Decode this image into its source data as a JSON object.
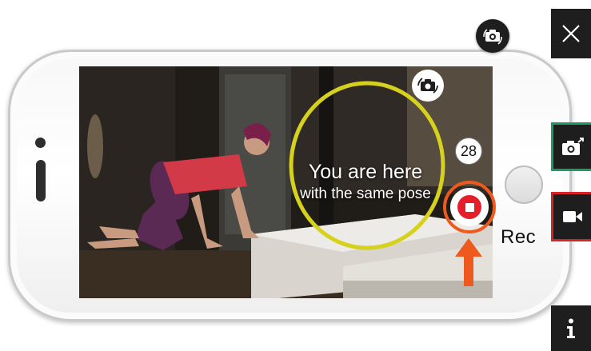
{
  "overlay": {
    "line1": "You are here",
    "line2": "with the same pose"
  },
  "counter": "28",
  "record": {
    "label": "Rec"
  },
  "colors": {
    "guide_circle": "#d6d11d",
    "record_ring": "#ee5a1e",
    "record_button": "#e41e2b",
    "arrow": "#ee5a1e",
    "photo_border": "#1f9a62",
    "video_border": "#d8222a",
    "toolbar": "#1e1e1e"
  },
  "icons": {
    "close": "close-icon",
    "photo": "camera-icon",
    "video": "video-camera-icon",
    "info": "info-icon",
    "flip": "switch-camera-icon",
    "stop": "stop-icon",
    "arrow": "arrow-up-icon"
  }
}
